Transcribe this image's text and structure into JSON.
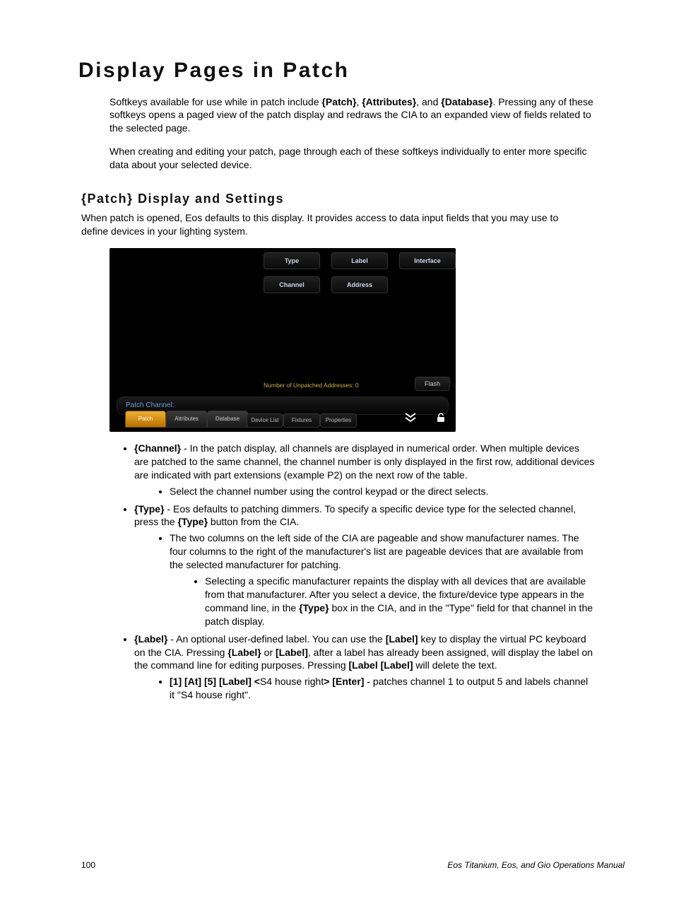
{
  "h1": "Display Pages in Patch",
  "p1_a": "Softkeys available for use while in patch include ",
  "p1_s1": "{Patch}",
  "p1_mid1": ", ",
  "p1_s2": "{Attributes}",
  "p1_mid2": ", and ",
  "p1_s3": "{Database}",
  "p1_b": ". Pressing any of these softkeys opens a paged view of the patch display and redraws the CIA to an expanded view of fields related to the selected page.",
  "p2": "When creating and editing your patch, page through each of these softkeys individually to enter more specific data about your selected device.",
  "h2": "{Patch} Display and Settings",
  "p3": "When patch is opened, Eos defaults to this display. It provides access to data input fields that you may use to define devices in your lighting system.",
  "ss": {
    "type": "Type",
    "label": "Label",
    "interface": "Interface",
    "channel": "Channel",
    "address": "Address",
    "status": "Number of Unpatched Addresses: 0",
    "flash": "Flash",
    "cmd": "Patch Channel:",
    "tabs": {
      "patch": "Patch",
      "attributes": "Attributes",
      "database": "Database"
    },
    "tabs2": {
      "devicelist": "Device List",
      "fixtures": "Fixtures",
      "properties": "Properties"
    }
  },
  "li1": {
    "key": "{Channel}",
    "text": " - In the patch display, all channels are displayed in numerical order. When multiple devices are patched to the same channel, the channel number is only displayed in the first row, additional devices are indicated with part extensions (example P2) on the next row of the table.",
    "sub1": "Select the channel number using the control keypad or the direct selects."
  },
  "li2": {
    "key": "{Type}",
    "text_a": " - Eos defaults to patching dimmers. To specify a specific device type for the selected channel, press the ",
    "key2": "{Type}",
    "text_b": " button from the CIA.",
    "sub1": "The two columns on the left side of the CIA are pageable and show manufacturer names. The four columns to the right of the manufacturer's list are pageable devices that are available from the selected manufacturer for patching.",
    "subsub_a": "Selecting a specific manufacturer repaints the display with all devices that are available from that manufacturer. After you select a device, the fixture/device type appears in the command line, in the ",
    "subsub_key": "{Type}",
    "subsub_b": " box in the CIA, and in the \"Type\" field for that channel in the patch display."
  },
  "li3": {
    "key": "{Label}",
    "text_a": " - An optional user-defined label. You can use the ",
    "k1": "[Label]",
    "text_b": " key to display the virtual PC keyboard on the CIA. Pressing ",
    "k2": "{Label}",
    "text_c": " or ",
    "k3": "[Label]",
    "text_d": ", after a label has already been assigned, will display the label on the command line for editing purposes. Pressing ",
    "k4": "[Label [Label]",
    "text_e": " will delete the text.",
    "sub_k": "[1] [At] [5] [Label] <",
    "sub_mid": "S4 house right",
    "sub_k2": "> [Enter]",
    "sub_text": " - patches channel 1 to output 5 and labels channel it \"S4 house right\"."
  },
  "footer": {
    "page": "100",
    "title": "Eos Titanium, Eos, and Gio Operations Manual"
  }
}
